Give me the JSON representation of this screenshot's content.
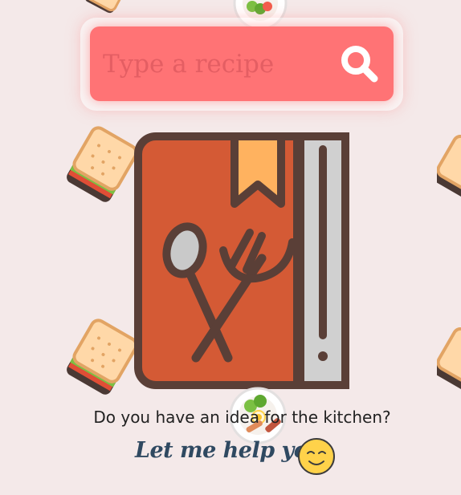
{
  "search": {
    "placeholder": "Type a recipe",
    "icon": "search-icon"
  },
  "hero": {
    "icon": "recipe-book-icon"
  },
  "tagline": "Do you have an idea for the kitchen?",
  "cta": "Let me help you",
  "cta_icon": "smiley-icon",
  "background_icons": [
    "sandwich-icon",
    "salad-plate-icon"
  ],
  "colors": {
    "background": "#f4e9e9",
    "search_bar": "#ff7375",
    "book_cover": "#d45a35",
    "book_outline": "#5a3f37",
    "bookmark": "#ffb25f",
    "spine": "#d0d0d0",
    "cta_text": "#2f4961",
    "smiley": "#ffd24a"
  }
}
